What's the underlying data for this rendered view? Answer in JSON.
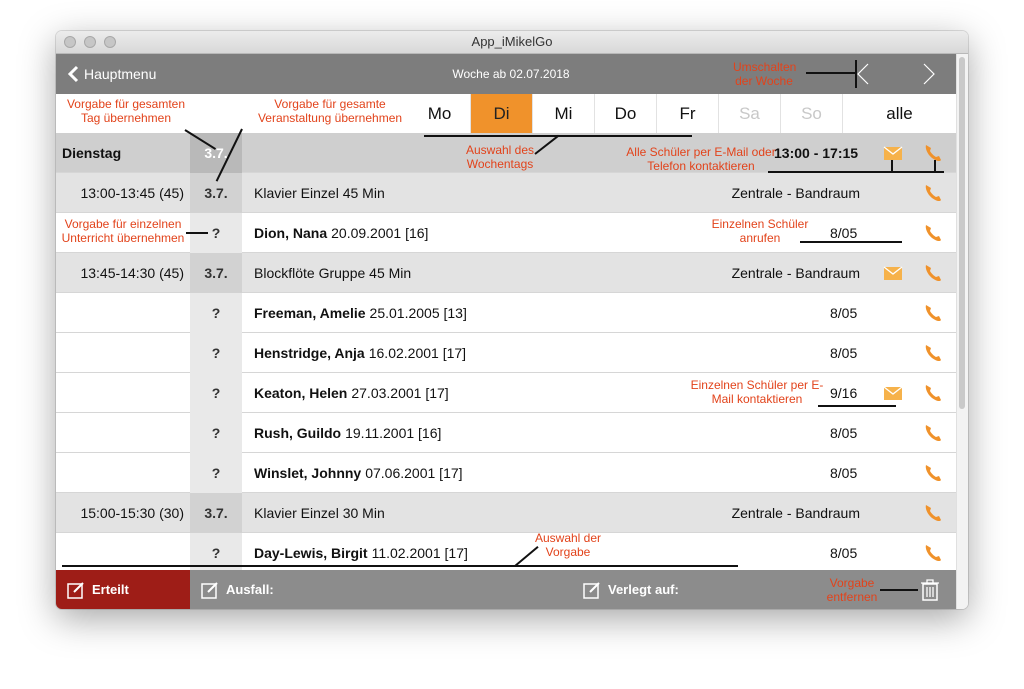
{
  "window": {
    "title": "App_iMikelGo"
  },
  "nav": {
    "back_label": "Hauptmenu",
    "week_label": "Woche ab 02.07.2018",
    "prev": "‹",
    "next": "›"
  },
  "day_tabs": [
    {
      "label": "Mo",
      "state": "normal"
    },
    {
      "label": "Di",
      "state": "active"
    },
    {
      "label": "Mi",
      "state": "normal"
    },
    {
      "label": "Do",
      "state": "normal"
    },
    {
      "label": "Fr",
      "state": "normal"
    },
    {
      "label": "Sa",
      "state": "disabled"
    },
    {
      "label": "So",
      "state": "disabled"
    },
    {
      "label": "alle",
      "state": "normal"
    }
  ],
  "header_row": {
    "day": "Dienstag",
    "mark": "3.7.",
    "time_range": "13:00 - 17:15"
  },
  "rows": [
    {
      "type": "group",
      "time": "13:00-13:45 (45)",
      "mark": "3.7.",
      "title": "Klavier Einzel 45 Min",
      "location": "Zentrale - Bandraum",
      "mail": false,
      "phone": true
    },
    {
      "type": "student",
      "mark": "?",
      "name": "Dion, Nana",
      "details": "20.09.2001 [16]",
      "value": "8/05",
      "mail": false,
      "phone": true
    },
    {
      "type": "group",
      "time": "13:45-14:30 (45)",
      "mark": "3.7.",
      "title": "Blockflöte Gruppe 45 Min",
      "location": "Zentrale - Bandraum",
      "mail": true,
      "phone": true
    },
    {
      "type": "student",
      "mark": "?",
      "name": "Freeman, Amelie",
      "details": "25.01.2005 [13]",
      "value": "8/05",
      "mail": false,
      "phone": true
    },
    {
      "type": "student",
      "mark": "?",
      "name": "Henstridge, Anja",
      "details": "16.02.2001 [17]",
      "value": "8/05",
      "mail": false,
      "phone": true
    },
    {
      "type": "student",
      "mark": "?",
      "name": "Keaton, Helen",
      "details": "27.03.2001 [17]",
      "value": "9/16",
      "mail": true,
      "phone": true
    },
    {
      "type": "student",
      "mark": "?",
      "name": "Rush, Guildo",
      "details": "19.11.2001 [16]",
      "value": "8/05",
      "mail": false,
      "phone": true
    },
    {
      "type": "student",
      "mark": "?",
      "name": "Winslet, Johnny",
      "details": "07.06.2001 [17]",
      "value": "8/05",
      "mail": false,
      "phone": true
    },
    {
      "type": "group",
      "time": "15:00-15:30 (30)",
      "mark": "3.7.",
      "title": "Klavier Einzel 30 Min",
      "location": "Zentrale - Bandraum",
      "mail": false,
      "phone": true
    },
    {
      "type": "student",
      "mark": "?",
      "name": "Day-Lewis, Birgit",
      "details": "11.02.2001 [17]",
      "value": "8/05",
      "mail": false,
      "phone": true
    }
  ],
  "footer": {
    "erteilt": "Erteilt",
    "ausfall": "Ausfall:",
    "verlegt": "Verlegt auf:"
  },
  "annotations": {
    "umschalten": "Umschalten der Woche",
    "vorgabe_tag": "Vorgabe für gesamten Tag übernehmen",
    "vorgabe_veranstaltung": "Vorgabe für gesamte Veranstaltung übernehmen",
    "auswahl_wochentag": "Auswahl des Wochentags",
    "alle_schueler": "Alle Schüler per E-Mail oder Telefon kontaktieren",
    "vorgabe_einzeln": "Vorgabe für einzelnen Unterricht übernehmen",
    "einzelnen_anrufen": "Einzelnen Schüler anrufen",
    "einzelnen_email": "Einzelnen Schüler per E-Mail kontaktieren",
    "auswahl_vorgabe": "Auswahl der Vorgabe",
    "vorgabe_entfernen": "Vorgabe entfernen"
  },
  "colors": {
    "accent": "#f0922b",
    "navbar": "#7d7d7d",
    "erteilt": "#9e1d17",
    "annotation": "#e2431b",
    "icon_orange": "#f0922b",
    "mail_orange": "#f6b24b"
  }
}
